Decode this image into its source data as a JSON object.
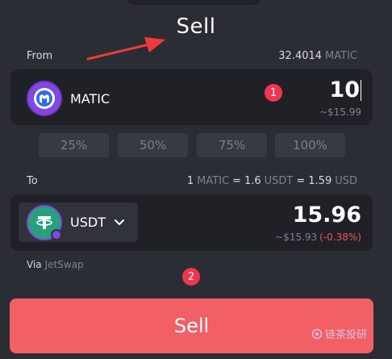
{
  "page": {
    "title": "Sell"
  },
  "from": {
    "label": "From",
    "balance_value": "32.4014",
    "balance_unit": "MATIC",
    "token": "MATIC",
    "amount": "10",
    "usd": "~$15.99",
    "token_color": "#8247e5"
  },
  "percent_buttons": [
    "25%",
    "50%",
    "75%",
    "100%"
  ],
  "to": {
    "label": "To",
    "rate_lhs_amount": "1",
    "rate_lhs_unit": "MATIC",
    "rate_eq1": "=",
    "rate_mid_amount": "1.6",
    "rate_mid_unit": "USDT",
    "rate_eq2": "=",
    "rate_rhs_amount": "1.59",
    "rate_rhs_unit": "USD",
    "token": "USDT",
    "amount": "15.96",
    "usd": "~$15.93",
    "change": "(-0.38%)",
    "token_color": "#26a17b",
    "change_color": "#f0505a"
  },
  "route": {
    "prefix": "Via",
    "name": "JetSwap"
  },
  "annotations": {
    "marker1": "1",
    "marker2": "2"
  },
  "sell_button": {
    "label": "Sell",
    "color": "#f25f65"
  },
  "watermark": {
    "text": "链茶投研"
  }
}
